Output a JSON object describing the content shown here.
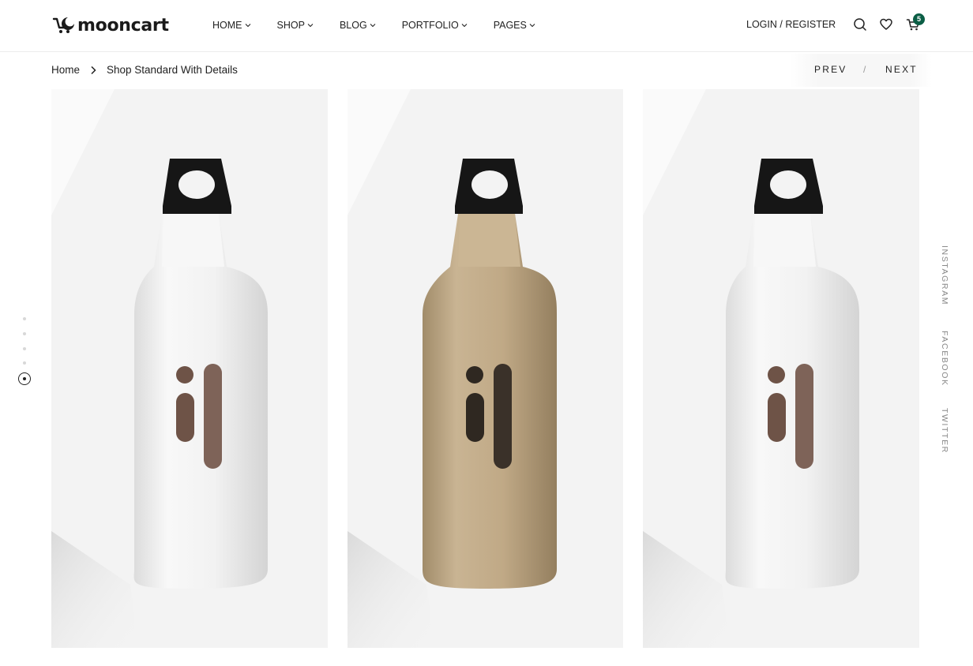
{
  "brand": {
    "name": "mooncart"
  },
  "nav": {
    "items": [
      {
        "label": "HOME"
      },
      {
        "label": "SHOP"
      },
      {
        "label": "BLOG"
      },
      {
        "label": "PORTFOLIO"
      },
      {
        "label": "PAGES"
      }
    ]
  },
  "header": {
    "login_label": "LOGIN / REGISTER",
    "cart_count": "5",
    "icons": [
      "search-icon",
      "heart-icon",
      "cart-icon"
    ]
  },
  "breadcrumb": {
    "home": "Home",
    "current": "Shop Standard With Details"
  },
  "pager": {
    "prev": "PREV",
    "separator": "/",
    "next": "NEXT"
  },
  "gallery": {
    "images": [
      {
        "color": "white",
        "body_hex": "#f4f4f4"
      },
      {
        "color": "tan",
        "body_hex": "#c2ac88"
      },
      {
        "color": "white",
        "body_hex": "#f4f4f4"
      }
    ],
    "slide_count": 5,
    "active_slide": 5
  },
  "social": {
    "items": [
      "INSTAGRAM",
      "FACEBOOK",
      "TWITTER"
    ]
  },
  "colors": {
    "accent": "#0b5e45",
    "text": "#222222",
    "panel": "#f3f3f3"
  }
}
